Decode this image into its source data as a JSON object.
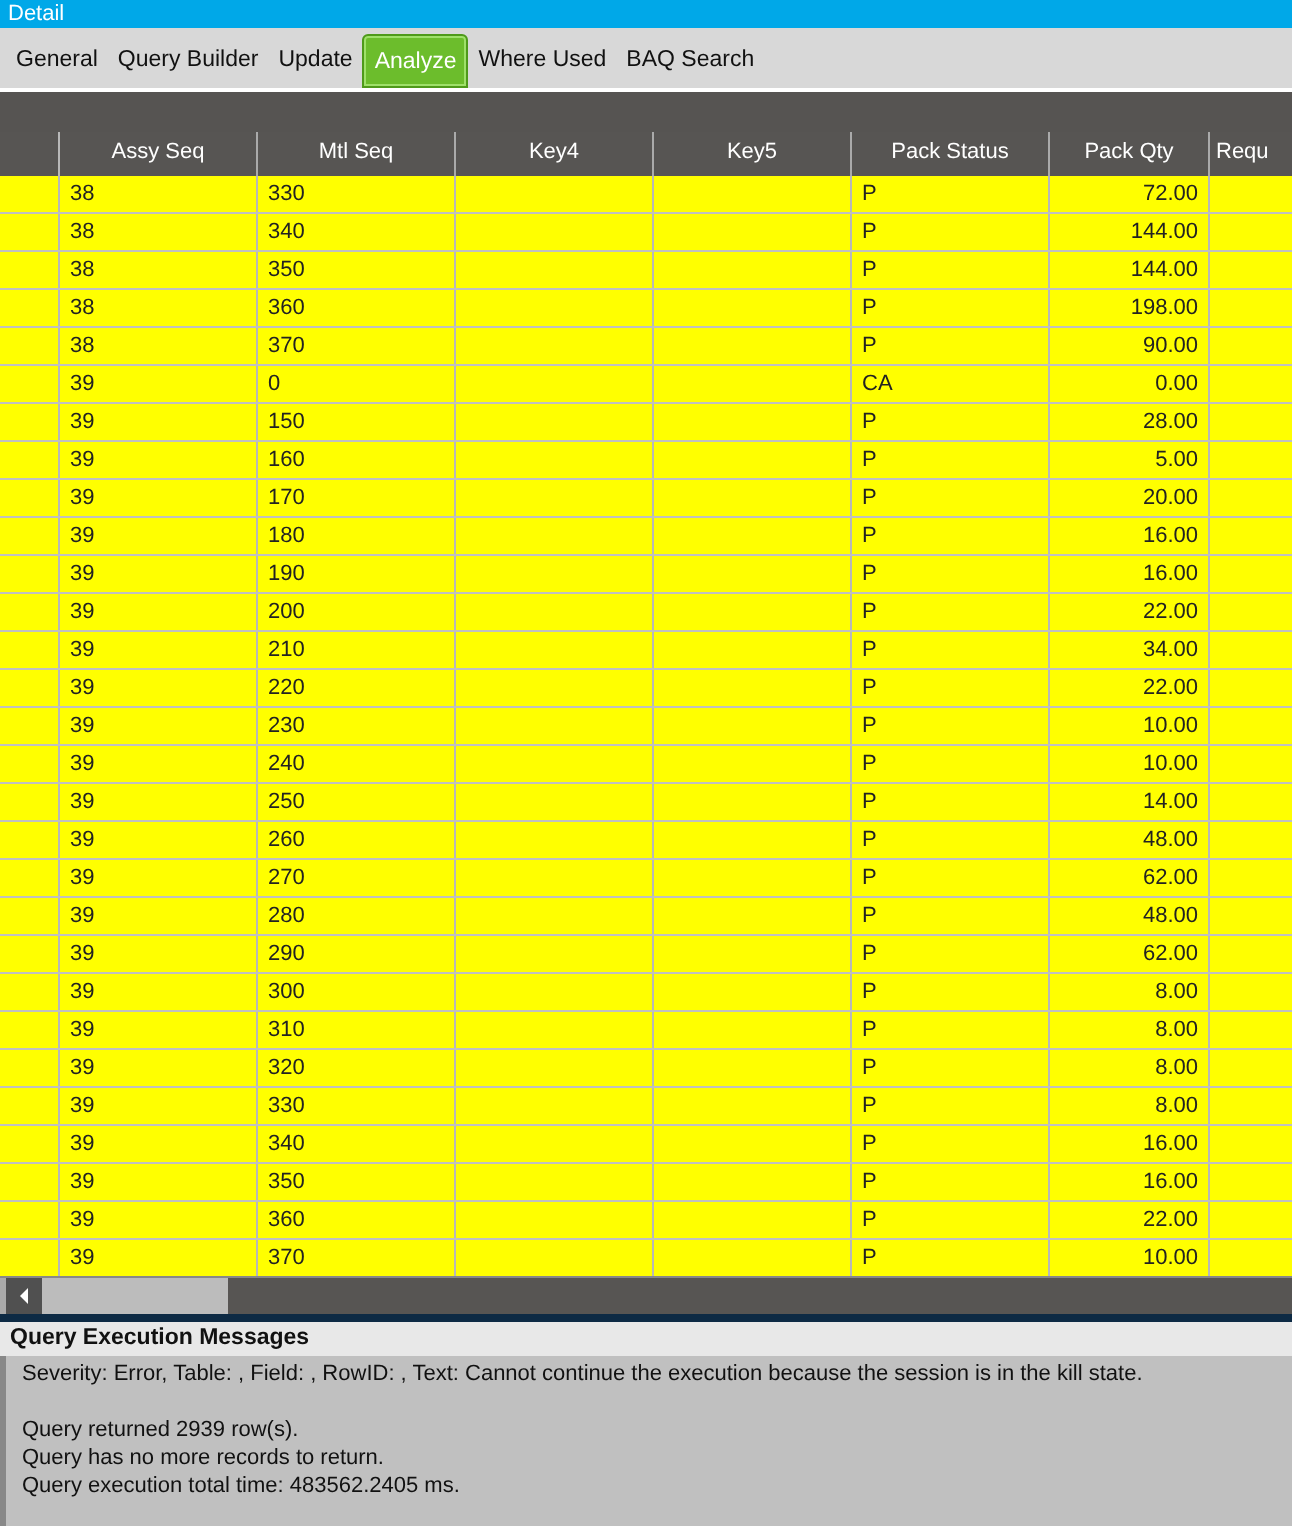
{
  "window": {
    "title": "Detail"
  },
  "tabs": [
    {
      "label": "General",
      "selected": false
    },
    {
      "label": "Query Builder",
      "selected": false
    },
    {
      "label": "Update",
      "selected": false
    },
    {
      "label": "Analyze",
      "selected": true
    },
    {
      "label": "Where Used",
      "selected": false
    },
    {
      "label": "BAQ Search",
      "selected": false
    }
  ],
  "table": {
    "columns": [
      "Assy Seq",
      "Mtl Seq",
      "Key4",
      "Key5",
      "Pack Status",
      "Pack Qty",
      "Requ"
    ],
    "rows": [
      [
        "38",
        "330",
        "",
        "",
        "P",
        "72.00",
        ""
      ],
      [
        "38",
        "340",
        "",
        "",
        "P",
        "144.00",
        ""
      ],
      [
        "38",
        "350",
        "",
        "",
        "P",
        "144.00",
        ""
      ],
      [
        "38",
        "360",
        "",
        "",
        "P",
        "198.00",
        ""
      ],
      [
        "38",
        "370",
        "",
        "",
        "P",
        "90.00",
        ""
      ],
      [
        "39",
        "0",
        "",
        "",
        "CA",
        "0.00",
        ""
      ],
      [
        "39",
        "150",
        "",
        "",
        "P",
        "28.00",
        ""
      ],
      [
        "39",
        "160",
        "",
        "",
        "P",
        "5.00",
        ""
      ],
      [
        "39",
        "170",
        "",
        "",
        "P",
        "20.00",
        ""
      ],
      [
        "39",
        "180",
        "",
        "",
        "P",
        "16.00",
        ""
      ],
      [
        "39",
        "190",
        "",
        "",
        "P",
        "16.00",
        ""
      ],
      [
        "39",
        "200",
        "",
        "",
        "P",
        "22.00",
        ""
      ],
      [
        "39",
        "210",
        "",
        "",
        "P",
        "34.00",
        ""
      ],
      [
        "39",
        "220",
        "",
        "",
        "P",
        "22.00",
        ""
      ],
      [
        "39",
        "230",
        "",
        "",
        "P",
        "10.00",
        ""
      ],
      [
        "39",
        "240",
        "",
        "",
        "P",
        "10.00",
        ""
      ],
      [
        "39",
        "250",
        "",
        "",
        "P",
        "14.00",
        ""
      ],
      [
        "39",
        "260",
        "",
        "",
        "P",
        "48.00",
        ""
      ],
      [
        "39",
        "270",
        "",
        "",
        "P",
        "62.00",
        ""
      ],
      [
        "39",
        "280",
        "",
        "",
        "P",
        "48.00",
        ""
      ],
      [
        "39",
        "290",
        "",
        "",
        "P",
        "62.00",
        ""
      ],
      [
        "39",
        "300",
        "",
        "",
        "P",
        "8.00",
        ""
      ],
      [
        "39",
        "310",
        "",
        "",
        "P",
        "8.00",
        ""
      ],
      [
        "39",
        "320",
        "",
        "",
        "P",
        "8.00",
        ""
      ],
      [
        "39",
        "330",
        "",
        "",
        "P",
        "8.00",
        ""
      ],
      [
        "39",
        "340",
        "",
        "",
        "P",
        "16.00",
        ""
      ],
      [
        "39",
        "350",
        "",
        "",
        "P",
        "16.00",
        ""
      ],
      [
        "39",
        "360",
        "",
        "",
        "P",
        "22.00",
        ""
      ],
      [
        "39",
        "370",
        "",
        "",
        "P",
        "10.00",
        ""
      ]
    ]
  },
  "messages": {
    "title": "Query Execution Messages",
    "paragraphs": [
      [
        "Severity: Error, Table: , Field: , RowID: , Text: Cannot continue the execution because the session is in the kill state."
      ],
      [
        "Query returned 2939 row(s).",
        "Query has no more records to return.",
        "Query execution total time: 483562.2405 ms."
      ]
    ]
  }
}
